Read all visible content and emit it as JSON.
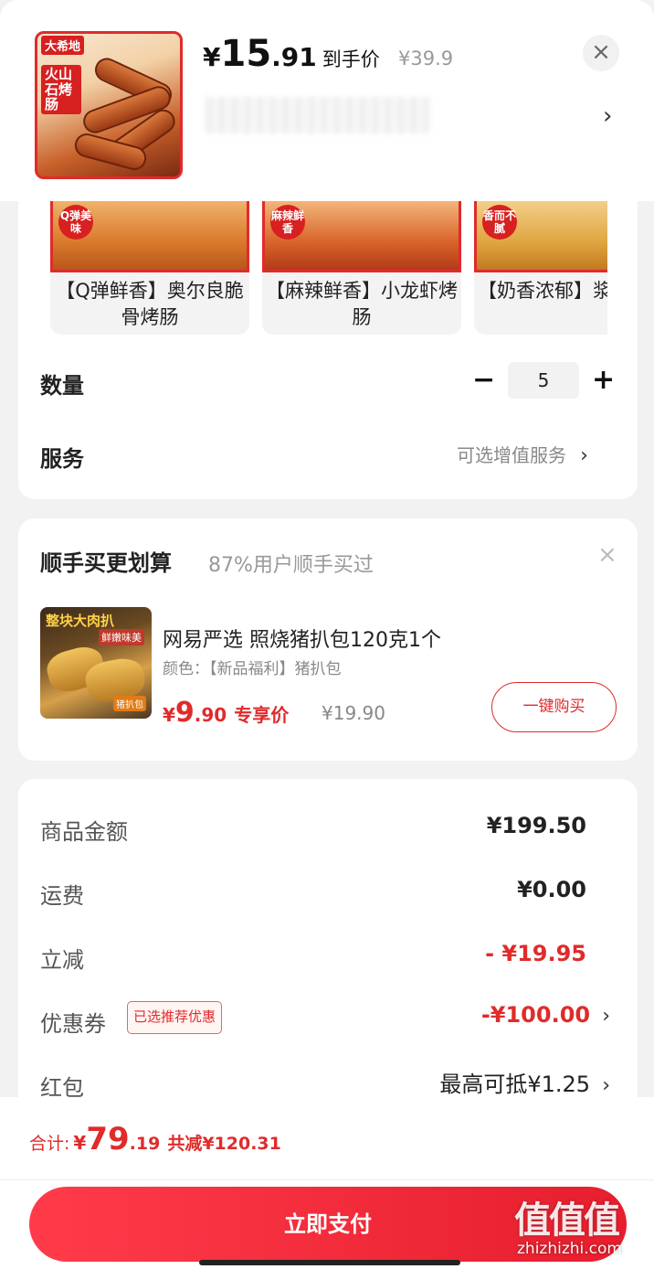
{
  "product": {
    "brand": "大希地",
    "image_tag": "火山石烤肠",
    "price_yen": "¥",
    "price_int": "15",
    "price_dec": ".91",
    "price_label": "到手价",
    "original_price": "¥39.9",
    "close_icon": "×",
    "chevron": "›"
  },
  "variants": [
    {
      "badge": "Q弹美味",
      "label": "【Q弹鲜香】奥尔良脆骨烤肠"
    },
    {
      "badge": "麻辣鲜香",
      "label": "【麻辣鲜香】小龙虾烤肠"
    },
    {
      "badge": "香而不腻",
      "label": "【奶香浓郁】浆芝士烤"
    }
  ],
  "quantity": {
    "label": "数量",
    "minus": "−",
    "value": "5",
    "plus": "+"
  },
  "service": {
    "label": "服务",
    "value": "可选增值服务",
    "chevron": "›"
  },
  "addon": {
    "title": "顺手买更划算",
    "subtitle": "87%用户顺手买过",
    "close_icon": "×",
    "image_title": "整块大肉扒",
    "image_sub": "鲜嫩味美",
    "image_tag": "猪扒包",
    "name": "网易严选 照烧猪扒包120克1个",
    "spec": "颜色：【新品福利】猪扒包",
    "price_yen": "¥",
    "price_int": "9",
    "price_dec": ".90",
    "price_label": "专享价",
    "original_price": "¥19.90",
    "buy_label": "一键购买"
  },
  "summary": {
    "rows": [
      {
        "label": "商品金额",
        "value": "¥199.50"
      },
      {
        "label": "运费",
        "value": "¥0.00"
      },
      {
        "label": "立减",
        "value": "- ¥19.95"
      },
      {
        "label": "优惠券",
        "tag": "已选推荐优惠",
        "value": "-¥100.00"
      },
      {
        "label": "红包",
        "value": "最高可抵¥1.25"
      }
    ],
    "chevron": "›"
  },
  "footer": {
    "total_label": "合计:",
    "total_yen": "¥",
    "total_int": "79",
    "total_dec": ".19",
    "saved": "共减¥120.31",
    "pay_label": "立即支付",
    "watermark": "值值值",
    "watermark_url": "zhizhizhi.com"
  },
  "colors": {
    "accent_red": "#e02b2b",
    "pay_button": "#ff3b4a",
    "background": "#f2f2f2"
  }
}
